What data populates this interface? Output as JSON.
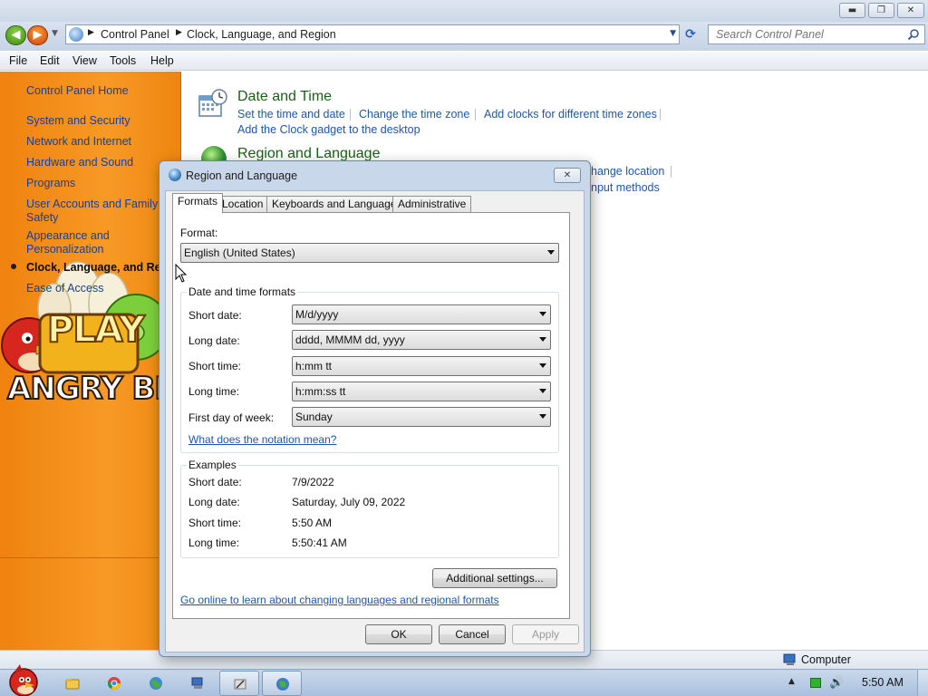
{
  "window": {
    "caption_buttons": {
      "minimize": "▬",
      "maximize": "❐",
      "close": "✕"
    }
  },
  "navigation": {
    "back_glyph": "◀",
    "forward_glyph": "▶",
    "breadcrumbs": [
      "Control Panel",
      "Clock, Language, and Region"
    ],
    "search_placeholder": "Search Control Panel"
  },
  "menu": [
    "File",
    "Edit",
    "View",
    "Tools",
    "Help"
  ],
  "sidebar": {
    "items": [
      {
        "label": "Control Panel Home"
      },
      {
        "label": "System and Security"
      },
      {
        "label": "Network and Internet"
      },
      {
        "label": "Hardware and Sound"
      },
      {
        "label": "Programs"
      },
      {
        "label": "User Accounts and Family Safety"
      },
      {
        "label": "Appearance and Personalization"
      },
      {
        "label": "Clock, Language, and Region"
      },
      {
        "label": "Ease of Access"
      }
    ],
    "current_index": 7,
    "wallpaper": {
      "play_text": "PLAY",
      "logo_text": "ANGRY BIRDS"
    }
  },
  "content": {
    "categories": [
      {
        "title": "Date and Time",
        "links": [
          "Set the time and date",
          "Change the time zone",
          "Add clocks for different time zones",
          "Add the Clock gadget to the desktop"
        ]
      },
      {
        "title": "Region and Language",
        "partial_links": [
          "hange location",
          "nput methods"
        ]
      }
    ]
  },
  "dialog": {
    "title": "Region and Language",
    "close_glyph": "✕",
    "tabs": [
      "Formats",
      "Location",
      "Keyboards and Languages",
      "Administrative"
    ],
    "selected_tab": "Formats",
    "format_label": "Format:",
    "format_value": "English (United States)",
    "date_time_group": {
      "title": "Date and time formats",
      "rows": [
        {
          "label": "Short date:",
          "value": "M/d/yyyy"
        },
        {
          "label": "Long date:",
          "value": "dddd, MMMM dd, yyyy"
        },
        {
          "label": "Short time:",
          "value": "h:mm tt"
        },
        {
          "label": "Long time:",
          "value": "h:mm:ss tt"
        },
        {
          "label": "First day of week:",
          "value": "Sunday"
        }
      ],
      "notation_link": "What does the notation mean?"
    },
    "examples_group": {
      "title": "Examples",
      "rows": [
        {
          "label": "Short date:",
          "value": "7/9/2022"
        },
        {
          "label": "Long date:",
          "value": "Saturday, July 09, 2022"
        },
        {
          "label": "Short time:",
          "value": "5:50 AM"
        },
        {
          "label": "Long time:",
          "value": "5:50:41 AM"
        }
      ]
    },
    "additional_settings": "Additional settings...",
    "online_link": "Go online to learn about changing languages and regional formats",
    "buttons": {
      "ok": "OK",
      "cancel": "Cancel",
      "apply": "Apply"
    }
  },
  "statusbar": {
    "text": "Computer"
  },
  "taskbar": {
    "clock": "5:50 AM",
    "tray_volume_glyph": "🔊",
    "tray_expand_glyph": "▲"
  },
  "colors": {
    "sidebar_orange": "#f79a25",
    "link_blue": "#1b57b2",
    "category_green": "#1a5e16",
    "dialog_frame": "#c8d7ea"
  }
}
